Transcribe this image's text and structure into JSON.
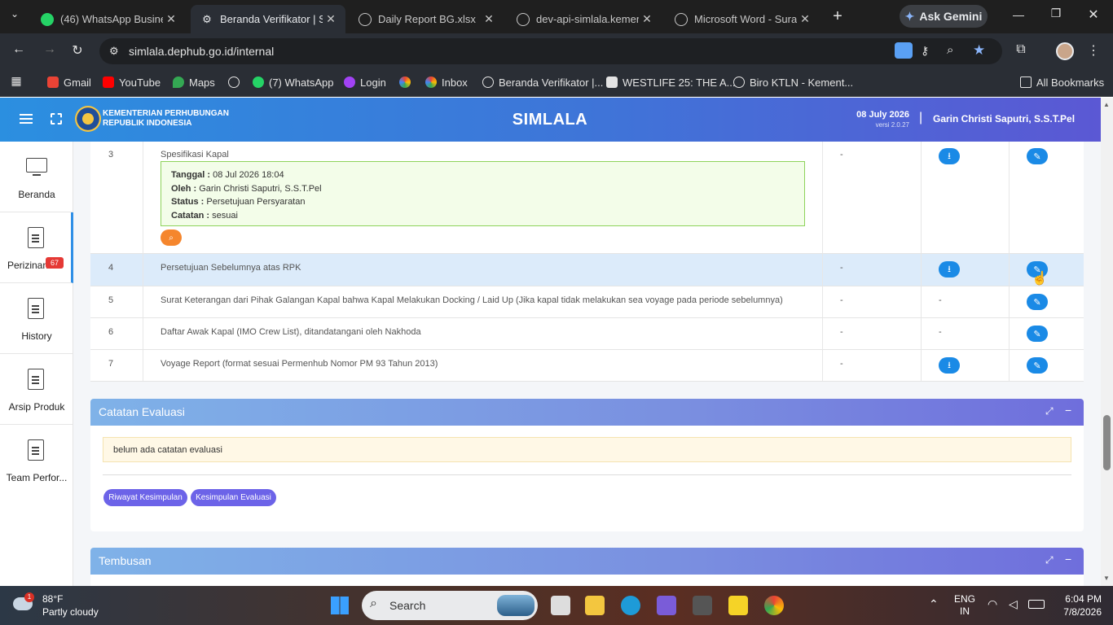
{
  "browser": {
    "tabs": [
      {
        "title": "(46) WhatsApp Busines",
        "active": false
      },
      {
        "title": "Beranda Verifikator | Si",
        "active": true
      },
      {
        "title": "Daily Report BG.xlsx",
        "active": false
      },
      {
        "title": "dev-api-simlala.kemen",
        "active": false
      },
      {
        "title": "Microsoft Word - Surat",
        "active": false
      }
    ],
    "wa_badge": "46",
    "ask_gemini": "Ask Gemini",
    "url": "simlala.dephub.go.id/internal",
    "bookmarks": [
      "Gmail",
      "YouTube",
      "Maps",
      "",
      "(7) WhatsApp",
      "Login",
      "",
      "Inbox",
      "Beranda Verifikator |...",
      "WESTLIFE 25: THE A...",
      "Biro KTLN - Kement..."
    ],
    "bookmark_badge": "46",
    "all_bookmarks": "All Bookmarks"
  },
  "header": {
    "org_line1": "KEMENTERIAN PERHUBUNGAN",
    "org_line2": "REPUBLIK INDONESIA",
    "app_title": "SIMLALA",
    "date": "08 July 2026",
    "version": "versi 2.0.27",
    "separator": "|",
    "user": "Garin Christi Saputri, S.S.T.Pel"
  },
  "sidebar": {
    "items": [
      {
        "label": "Beranda"
      },
      {
        "label": "Perizinan",
        "badge": "67"
      },
      {
        "label": "History"
      },
      {
        "label": "Arsip Produk"
      },
      {
        "label": "Team Perfor..."
      }
    ]
  },
  "table": {
    "rows": [
      {
        "no": "3",
        "name": "Spesifikasi Kapal",
        "col3": "-",
        "col4": "download",
        "col5": "edit"
      },
      {
        "no": "4",
        "name": "Persetujuan Sebelumnya atas RPK",
        "col3": "-",
        "col4": "download",
        "col5": "edit"
      },
      {
        "no": "5",
        "name": "Surat Keterangan dari Pihak Galangan Kapal bahwa Kapal Melakukan Docking / Laid Up (Jika kapal tidak melakukan sea voyage pada periode sebelumnya)",
        "col3": "-",
        "col4": "-",
        "col5": "edit"
      },
      {
        "no": "6",
        "name": "Daftar Awak Kapal (IMO Crew List), ditandatangani oleh Nakhoda",
        "col3": "-",
        "col4": "-",
        "col5": "edit"
      },
      {
        "no": "7",
        "name": "Voyage Report (format sesuai Permenhub Nomor PM 93 Tahun 2013)",
        "col3": "-",
        "col4": "download",
        "col5": "edit"
      }
    ],
    "note": {
      "tanggal_label": "Tanggal :",
      "tanggal": "08 Jul 2026 18:04",
      "oleh_label": "Oleh :",
      "oleh": "Garin Christi Saputri, S.S.T.Pel",
      "status_label": "Status :",
      "status": "Persetujuan Persyaratan",
      "catatan_label": "Catatan :",
      "catatan": "sesuai"
    }
  },
  "evaluasi": {
    "title": "Catatan Evaluasi",
    "empty_text": "belum ada catatan evaluasi",
    "btn_riwayat": "Riwayat Kesimpulan",
    "btn_kesimpulan": "Kesimpulan Evaluasi"
  },
  "tembusan": {
    "title": "Tembusan"
  },
  "taskbar": {
    "weather_temp": "88°F",
    "weather_desc": "Partly cloudy",
    "weather_badge": "1",
    "search": "Search",
    "lang1": "ENG",
    "lang2": "IN",
    "time": "6:04 PM",
    "date": "7/8/2026"
  },
  "colors": {
    "accent": "#1a8ae6",
    "purple_btn": "#6c63e8",
    "orange": "#f5862d",
    "note_bg": "#f3fde9",
    "note_border": "#8dd35a",
    "warning_bg": "#fff8e6"
  }
}
